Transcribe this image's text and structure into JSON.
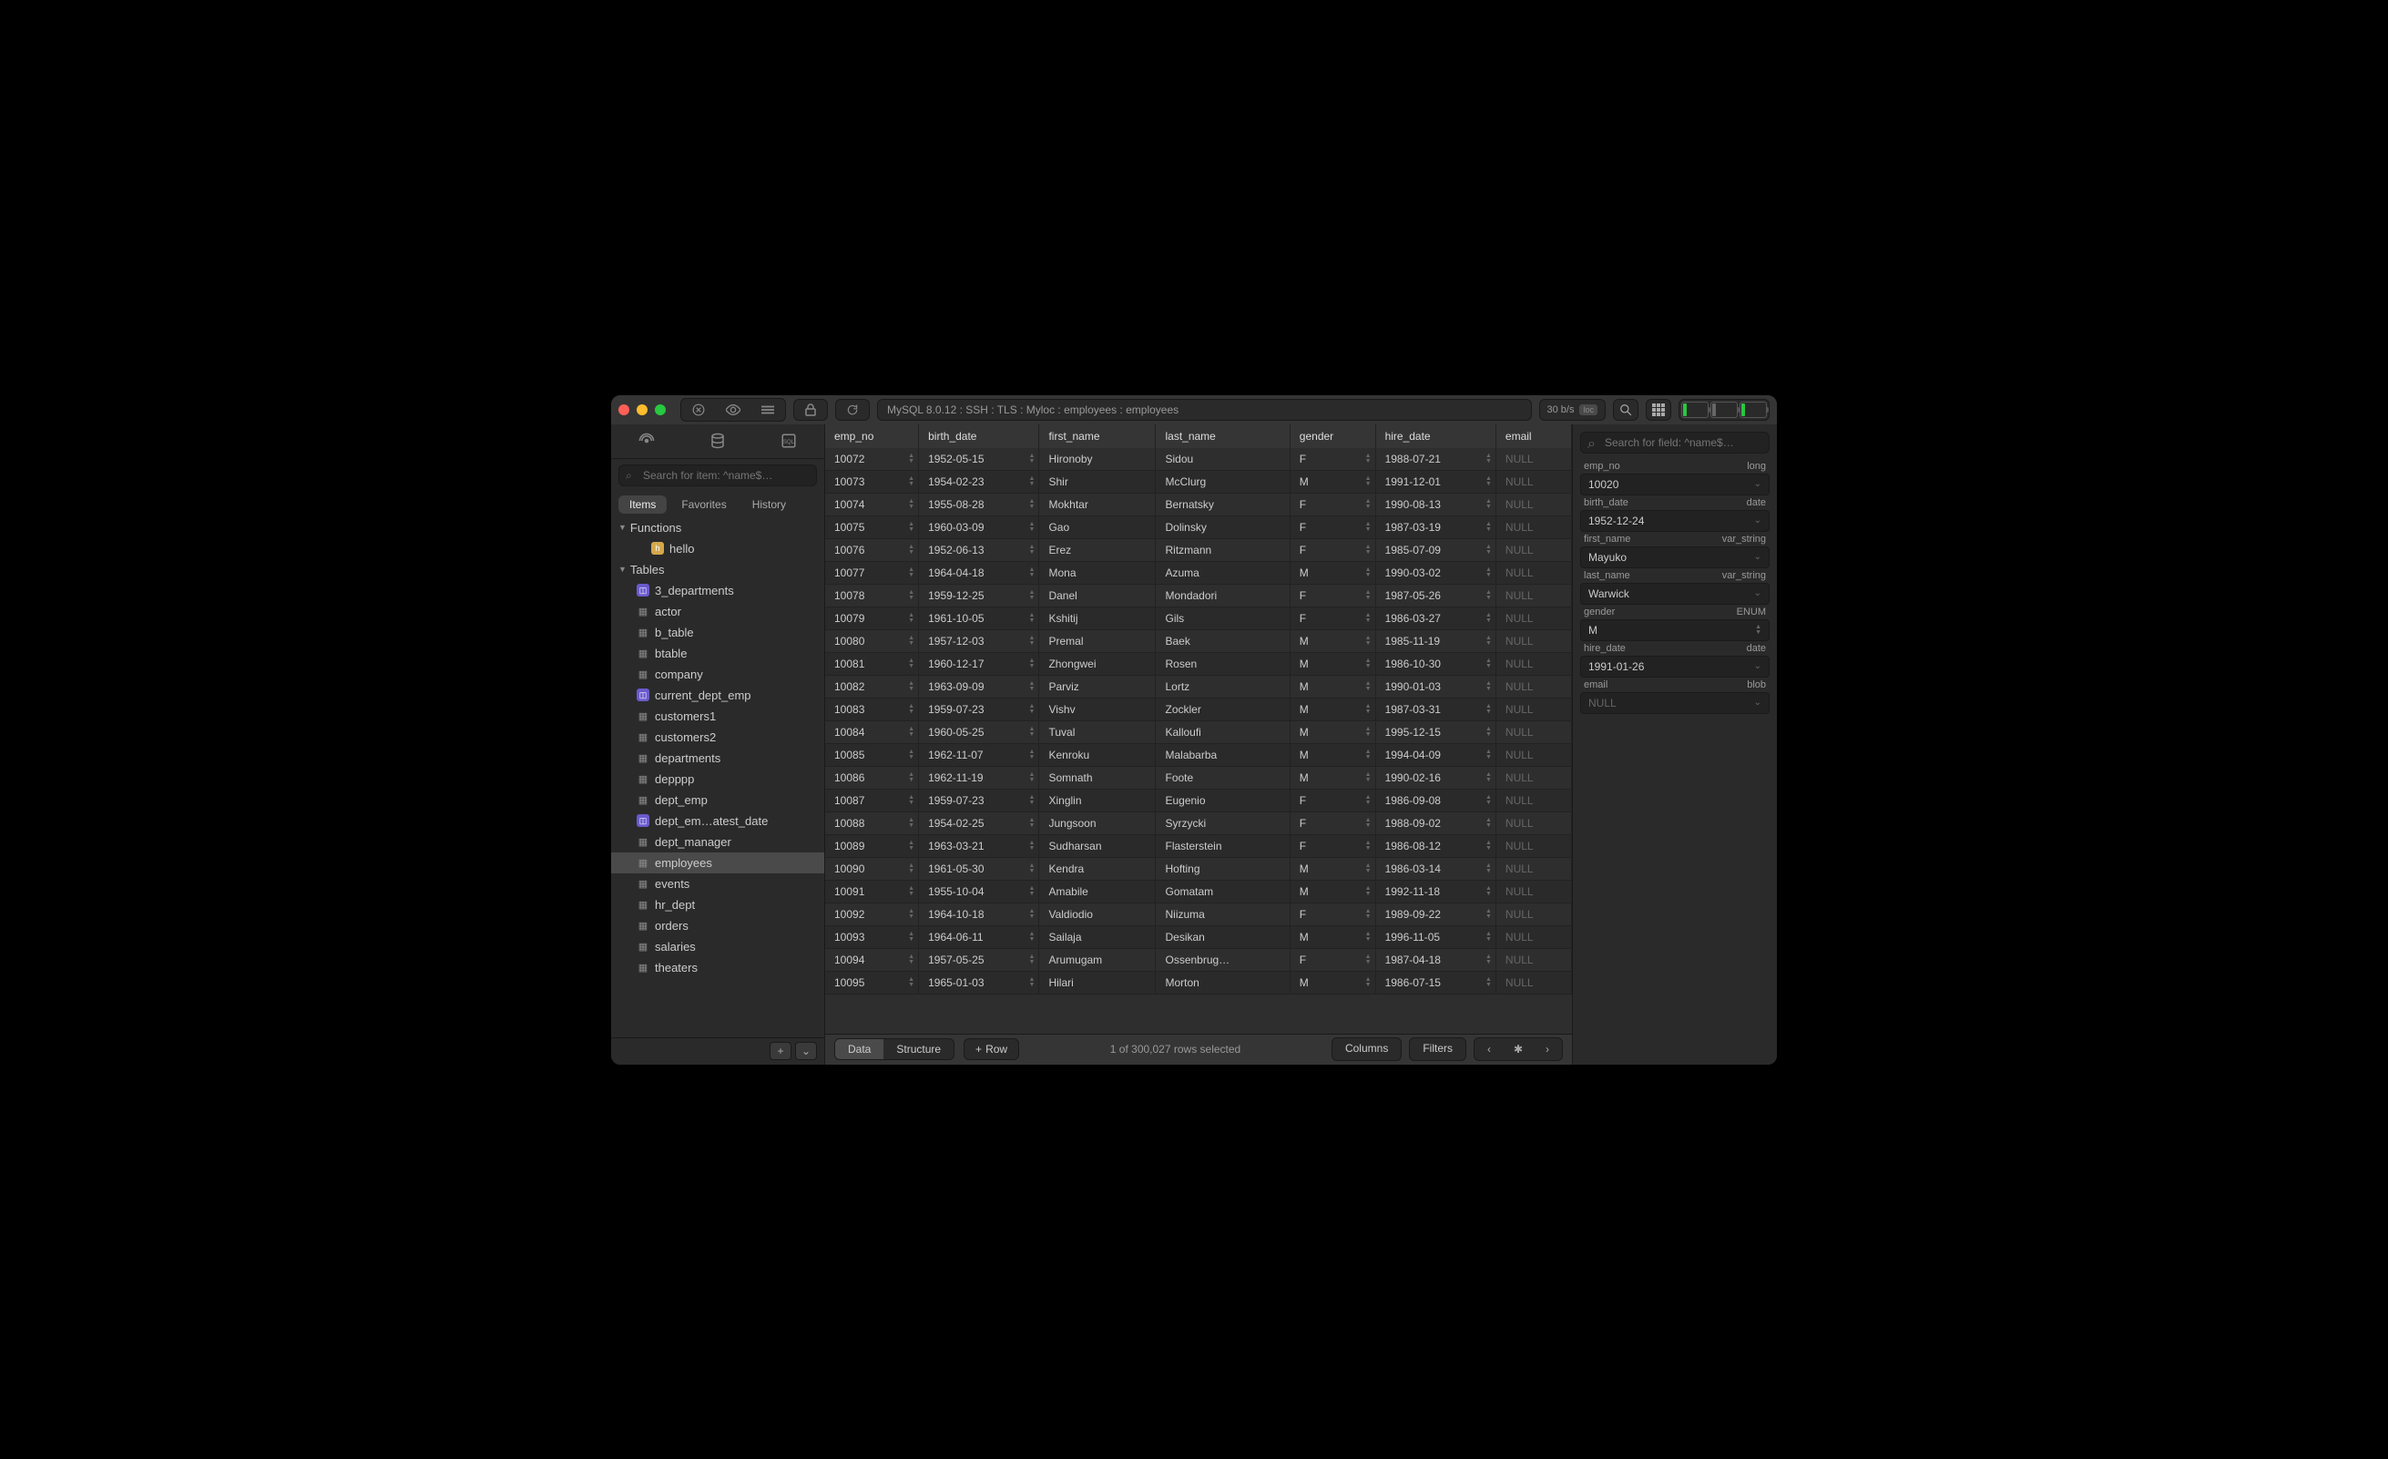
{
  "titlebar": {
    "breadcrumb": "MySQL 8.0.12 : SSH : TLS : Myloc : employees : employees",
    "status": "30 b/s",
    "loc_badge": "loc"
  },
  "sidebar": {
    "search_placeholder": "Search for item: ^name$…",
    "pills": {
      "items": "Items",
      "favorites": "Favorites",
      "history": "History"
    },
    "sections": {
      "functions": "Functions",
      "tables": "Tables"
    },
    "functions": [
      {
        "name": "hello",
        "type": "func"
      }
    ],
    "tables": [
      {
        "name": "3_departments",
        "type": "view"
      },
      {
        "name": "actor",
        "type": "table"
      },
      {
        "name": "b_table",
        "type": "table"
      },
      {
        "name": "btable",
        "type": "table"
      },
      {
        "name": "company",
        "type": "table"
      },
      {
        "name": "current_dept_emp",
        "type": "view"
      },
      {
        "name": "customers1",
        "type": "table"
      },
      {
        "name": "customers2",
        "type": "table"
      },
      {
        "name": "departments",
        "type": "table"
      },
      {
        "name": "depppp",
        "type": "table"
      },
      {
        "name": "dept_emp",
        "type": "table"
      },
      {
        "name": "dept_em…atest_date",
        "type": "view"
      },
      {
        "name": "dept_manager",
        "type": "table"
      },
      {
        "name": "employees",
        "type": "table",
        "selected": true
      },
      {
        "name": "events",
        "type": "table"
      },
      {
        "name": "hr_dept",
        "type": "table"
      },
      {
        "name": "orders",
        "type": "table"
      },
      {
        "name": "salaries",
        "type": "table"
      },
      {
        "name": "theaters",
        "type": "table"
      }
    ]
  },
  "table": {
    "columns": [
      "emp_no",
      "birth_date",
      "first_name",
      "last_name",
      "gender",
      "hire_date",
      "email"
    ],
    "rows": [
      [
        "10072",
        "1952-05-15",
        "Hironoby",
        "Sidou",
        "F",
        "1988-07-21",
        "NULL"
      ],
      [
        "10073",
        "1954-02-23",
        "Shir",
        "McClurg",
        "M",
        "1991-12-01",
        "NULL"
      ],
      [
        "10074",
        "1955-08-28",
        "Mokhtar",
        "Bernatsky",
        "F",
        "1990-08-13",
        "NULL"
      ],
      [
        "10075",
        "1960-03-09",
        "Gao",
        "Dolinsky",
        "F",
        "1987-03-19",
        "NULL"
      ],
      [
        "10076",
        "1952-06-13",
        "Erez",
        "Ritzmann",
        "F",
        "1985-07-09",
        "NULL"
      ],
      [
        "10077",
        "1964-04-18",
        "Mona",
        "Azuma",
        "M",
        "1990-03-02",
        "NULL"
      ],
      [
        "10078",
        "1959-12-25",
        "Danel",
        "Mondadori",
        "F",
        "1987-05-26",
        "NULL"
      ],
      [
        "10079",
        "1961-10-05",
        "Kshitij",
        "Gils",
        "F",
        "1986-03-27",
        "NULL"
      ],
      [
        "10080",
        "1957-12-03",
        "Premal",
        "Baek",
        "M",
        "1985-11-19",
        "NULL"
      ],
      [
        "10081",
        "1960-12-17",
        "Zhongwei",
        "Rosen",
        "M",
        "1986-10-30",
        "NULL"
      ],
      [
        "10082",
        "1963-09-09",
        "Parviz",
        "Lortz",
        "M",
        "1990-01-03",
        "NULL"
      ],
      [
        "10083",
        "1959-07-23",
        "Vishv",
        "Zockler",
        "M",
        "1987-03-31",
        "NULL"
      ],
      [
        "10084",
        "1960-05-25",
        "Tuval",
        "Kalloufi",
        "M",
        "1995-12-15",
        "NULL"
      ],
      [
        "10085",
        "1962-11-07",
        "Kenroku",
        "Malabarba",
        "M",
        "1994-04-09",
        "NULL"
      ],
      [
        "10086",
        "1962-11-19",
        "Somnath",
        "Foote",
        "M",
        "1990-02-16",
        "NULL"
      ],
      [
        "10087",
        "1959-07-23",
        "Xinglin",
        "Eugenio",
        "F",
        "1986-09-08",
        "NULL"
      ],
      [
        "10088",
        "1954-02-25",
        "Jungsoon",
        "Syrzycki",
        "F",
        "1988-09-02",
        "NULL"
      ],
      [
        "10089",
        "1963-03-21",
        "Sudharsan",
        "Flasterstein",
        "F",
        "1986-08-12",
        "NULL"
      ],
      [
        "10090",
        "1961-05-30",
        "Kendra",
        "Hofting",
        "M",
        "1986-03-14",
        "NULL"
      ],
      [
        "10091",
        "1955-10-04",
        "Amabile",
        "Gomatam",
        "M",
        "1992-11-18",
        "NULL"
      ],
      [
        "10092",
        "1964-10-18",
        "Valdiodio",
        "Niizuma",
        "F",
        "1989-09-22",
        "NULL"
      ],
      [
        "10093",
        "1964-06-11",
        "Sailaja",
        "Desikan",
        "M",
        "1996-11-05",
        "NULL"
      ],
      [
        "10094",
        "1957-05-25",
        "Arumugam",
        "Ossenbrug…",
        "F",
        "1987-04-18",
        "NULL"
      ],
      [
        "10095",
        "1965-01-03",
        "Hilari",
        "Morton",
        "M",
        "1986-07-15",
        "NULL"
      ]
    ]
  },
  "footer": {
    "data": "Data",
    "structure": "Structure",
    "row": "Row",
    "status": "1 of 300,027 rows selected",
    "columns": "Columns",
    "filters": "Filters"
  },
  "inspector": {
    "search_placeholder": "Search for field: ^name$…",
    "fields": [
      {
        "name": "emp_no",
        "type": "long",
        "value": "10020"
      },
      {
        "name": "birth_date",
        "type": "date",
        "value": "1952-12-24"
      },
      {
        "name": "first_name",
        "type": "var_string",
        "value": "Mayuko"
      },
      {
        "name": "last_name",
        "type": "var_string",
        "value": "Warwick"
      },
      {
        "name": "gender",
        "type": "ENUM",
        "value": "M",
        "enum": true
      },
      {
        "name": "hire_date",
        "type": "date",
        "value": "1991-01-26"
      },
      {
        "name": "email",
        "type": "blob",
        "value": "NULL",
        "null": true
      }
    ]
  }
}
